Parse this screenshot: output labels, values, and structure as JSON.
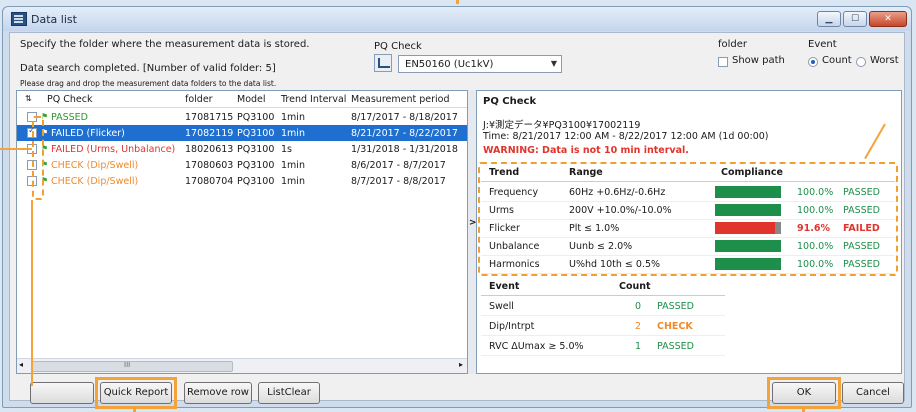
{
  "window": {
    "title": "Data list"
  },
  "top": {
    "instruction": "Specify the folder where the measurement data is stored.",
    "status": "Data search completed. [Number of valid folder: 5]",
    "hint": "Please drag and drop the measurement data folders to the data list."
  },
  "pqcheck": {
    "label": "PQ Check",
    "selected": "EN50160 (Uc1kV)"
  },
  "folder": {
    "label": "folder",
    "show_path": "Show path"
  },
  "event": {
    "label": "Event",
    "count": "Count",
    "worst": "Worst"
  },
  "list": {
    "headers": [
      "PQ Check",
      "folder",
      "Model",
      "Trend Interval",
      "Measurement period"
    ],
    "rows": [
      {
        "check": "PASSED",
        "folder": "17081715",
        "model": "PQ3100",
        "interval": "1min",
        "period": "8/17/2017 - 8/18/2017",
        "checked": false,
        "color": "#2c9a2c"
      },
      {
        "check": "FAILED (Flicker)",
        "folder": "17082119",
        "model": "PQ3100",
        "interval": "1min",
        "period": "8/21/2017 - 8/22/2017",
        "checked": true,
        "color": "#ffffff"
      },
      {
        "check": "FAILED (Urms, Unbalance)",
        "folder": "18020613",
        "model": "PQ3100",
        "interval": "1s",
        "period": "1/31/2018 - 1/31/2018",
        "checked": false,
        "color": "#e0342c"
      },
      {
        "check": "CHECK (Dip/Swell)",
        "folder": "17080603",
        "model": "PQ3100",
        "interval": "1min",
        "period": "8/6/2017 - 8/7/2017",
        "checked": false,
        "color": "#f08a2a"
      },
      {
        "check": "CHECK (Dip/Swell)",
        "folder": "17080704",
        "model": "PQ3100",
        "interval": "1min",
        "period": "8/7/2017 - 8/8/2017",
        "checked": false,
        "color": "#f08a2a"
      }
    ],
    "scroll_glyph": "III"
  },
  "detail": {
    "title": "PQ Check",
    "path": "J:¥測定データ¥PQ3100¥17002119",
    "time": "Time: 8/21/2017 12:00 AM - 8/22/2017 12:00 AM (1d 00:00)",
    "warning": "WARNING: Data is not 10 min interval.",
    "trend_headers": [
      "Trend",
      "Range",
      "Compliance"
    ],
    "trends": [
      {
        "name": "Frequency",
        "range": "60Hz +0.6Hz/-0.6Hz",
        "pct": "100.0%",
        "result": "PASSED",
        "fill": 1.0,
        "color": "#1e8f4a"
      },
      {
        "name": "Urms",
        "range": "200V +10.0%/-10.0%",
        "pct": "100.0%",
        "result": "PASSED",
        "fill": 1.0,
        "color": "#1e8f4a"
      },
      {
        "name": "Flicker",
        "range": "Plt ≤ 1.0%",
        "pct": "91.6%",
        "result": "FAILED",
        "fill": 0.916,
        "color": "#e0342c"
      },
      {
        "name": "Unbalance",
        "range": "Uunb ≤ 2.0%",
        "pct": "100.0%",
        "result": "PASSED",
        "fill": 1.0,
        "color": "#1e8f4a"
      },
      {
        "name": "Harmonics",
        "range": "U%hd 10th ≤ 0.5%",
        "pct": "100.0%",
        "result": "PASSED",
        "fill": 1.0,
        "color": "#1e8f4a"
      }
    ],
    "event_headers": [
      "Event",
      "Count"
    ],
    "events": [
      {
        "name": "Swell",
        "count": "0",
        "result": "PASSED",
        "color": "#1e8f4a"
      },
      {
        "name": "Dip/Intrpt",
        "count": "2",
        "result": "CHECK",
        "color": "#f08a2a"
      },
      {
        "name": "RVC ΔUmax ≥ 5.0%",
        "count": "1",
        "result": "PASSED",
        "color": "#1e8f4a"
      }
    ]
  },
  "buttons": {
    "quick_report": "Quick Report",
    "remove_row": "Remove row",
    "list_clear": "ListClear",
    "ok": "OK",
    "cancel": "Cancel"
  },
  "colors": {
    "accent": "#f3a33a",
    "selected_row": "#1e6fd0",
    "pass": "#1e8f4a",
    "fail": "#e0342c",
    "check": "#f08a2a"
  }
}
